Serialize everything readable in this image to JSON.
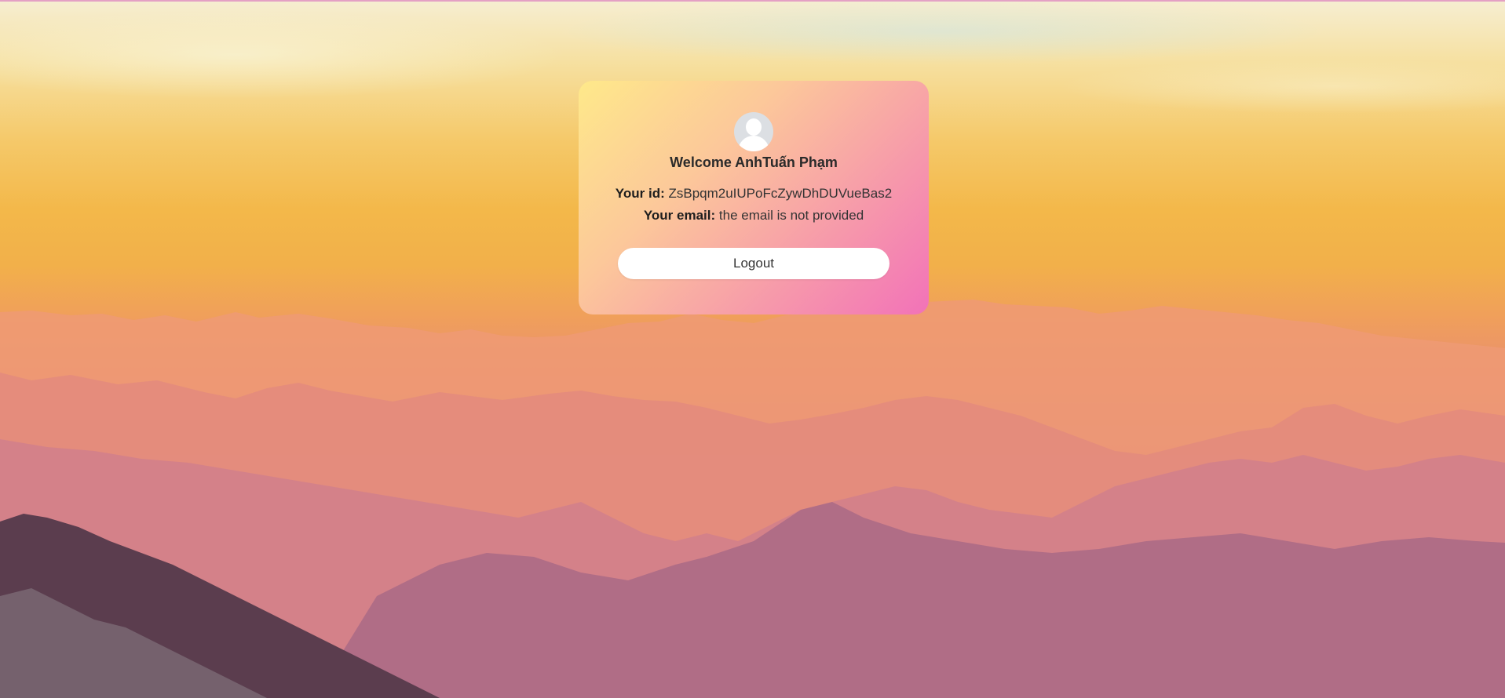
{
  "profile": {
    "welcome_text": "Welcome AnhTuấn Phạm",
    "id_label": "Your id:",
    "id_value": "ZsBpqm2uIUPoFcZywDhDUVueBas2",
    "email_label": "Your email:",
    "email_value": "the email is not provided",
    "logout_label": "Logout",
    "avatar_icon": "user-silhouette-icon"
  },
  "colors": {
    "card_gradient_start": "#fee98a",
    "card_gradient_end": "#f272b8",
    "button_bg": "#ffffff"
  }
}
